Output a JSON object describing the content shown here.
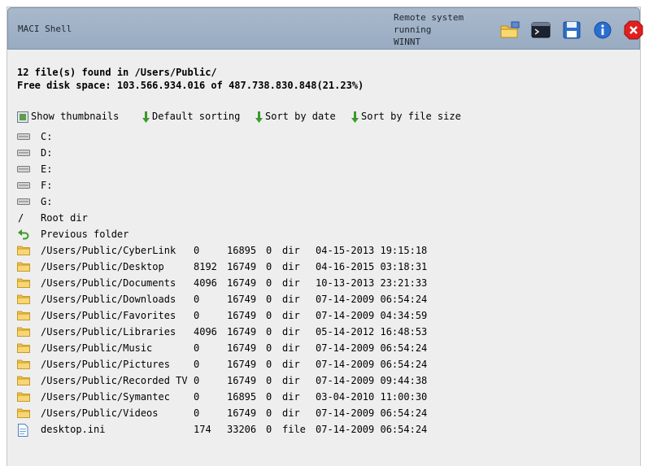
{
  "header": {
    "title": "MACI Shell",
    "remote_lines": [
      "Remote system",
      "running",
      "WINNT"
    ],
    "icons": [
      "upload-folder-icon",
      "terminal-icon",
      "save-icon",
      "info-icon",
      "close-icon"
    ]
  },
  "summary": {
    "files_line": "12 file(s) found in /Users/Public/",
    "disk_line": "Free disk space: 103.566.934.016 of 487.738.830.848(21.23%)"
  },
  "toolbar": {
    "show_thumbnails": "Show thumbnails",
    "default_sorting": "Default sorting",
    "sort_by_date": "Sort by date",
    "sort_by_size": "Sort by file size"
  },
  "drives": [
    "C:",
    "D:",
    "E:",
    "F:",
    "G:"
  ],
  "nav": {
    "root_symbol": "/",
    "root": "Root dir",
    "previous": "Previous folder"
  },
  "files": [
    {
      "name": "/Users/Public/CyberLink",
      "size": "0",
      "inode": "16895",
      "links": "0",
      "type": "dir",
      "date": "04-15-2013 19:15:18",
      "icon": "folder-icon"
    },
    {
      "name": "/Users/Public/Desktop",
      "size": "8192",
      "inode": "16749",
      "links": "0",
      "type": "dir",
      "date": "04-16-2015 03:18:31",
      "icon": "folder-icon"
    },
    {
      "name": "/Users/Public/Documents",
      "size": "4096",
      "inode": "16749",
      "links": "0",
      "type": "dir",
      "date": "10-13-2013 23:21:33",
      "icon": "folder-icon"
    },
    {
      "name": "/Users/Public/Downloads",
      "size": "0",
      "inode": "16749",
      "links": "0",
      "type": "dir",
      "date": "07-14-2009 06:54:24",
      "icon": "folder-icon"
    },
    {
      "name": "/Users/Public/Favorites",
      "size": "0",
      "inode": "16749",
      "links": "0",
      "type": "dir",
      "date": "07-14-2009 04:34:59",
      "icon": "folder-icon"
    },
    {
      "name": "/Users/Public/Libraries",
      "size": "4096",
      "inode": "16749",
      "links": "0",
      "type": "dir",
      "date": "05-14-2012 16:48:53",
      "icon": "folder-icon"
    },
    {
      "name": "/Users/Public/Music",
      "size": "0",
      "inode": "16749",
      "links": "0",
      "type": "dir",
      "date": "07-14-2009 06:54:24",
      "icon": "folder-icon"
    },
    {
      "name": "/Users/Public/Pictures",
      "size": "0",
      "inode": "16749",
      "links": "0",
      "type": "dir",
      "date": "07-14-2009 06:54:24",
      "icon": "folder-icon"
    },
    {
      "name": "/Users/Public/Recorded TV",
      "size": "0",
      "inode": "16749",
      "links": "0",
      "type": "dir",
      "date": "07-14-2009 09:44:38",
      "icon": "folder-icon"
    },
    {
      "name": "/Users/Public/Symantec",
      "size": "0",
      "inode": "16895",
      "links": "0",
      "type": "dir",
      "date": "03-04-2010 11:00:30",
      "icon": "folder-icon"
    },
    {
      "name": "/Users/Public/Videos",
      "size": "0",
      "inode": "16749",
      "links": "0",
      "type": "dir",
      "date": "07-14-2009 06:54:24",
      "icon": "folder-icon"
    },
    {
      "name": "desktop.ini",
      "size": "174",
      "inode": "33206",
      "links": "0",
      "type": "file",
      "date": "07-14-2009 06:54:24",
      "icon": "file-icon"
    }
  ],
  "colors": {
    "header_bg": "#a9b9cc",
    "panel_bg": "#eeeeee",
    "folder": "#f2c14e",
    "arrow": "#3a9a2a",
    "close": "#e02020",
    "info": "#2a6fd0"
  }
}
